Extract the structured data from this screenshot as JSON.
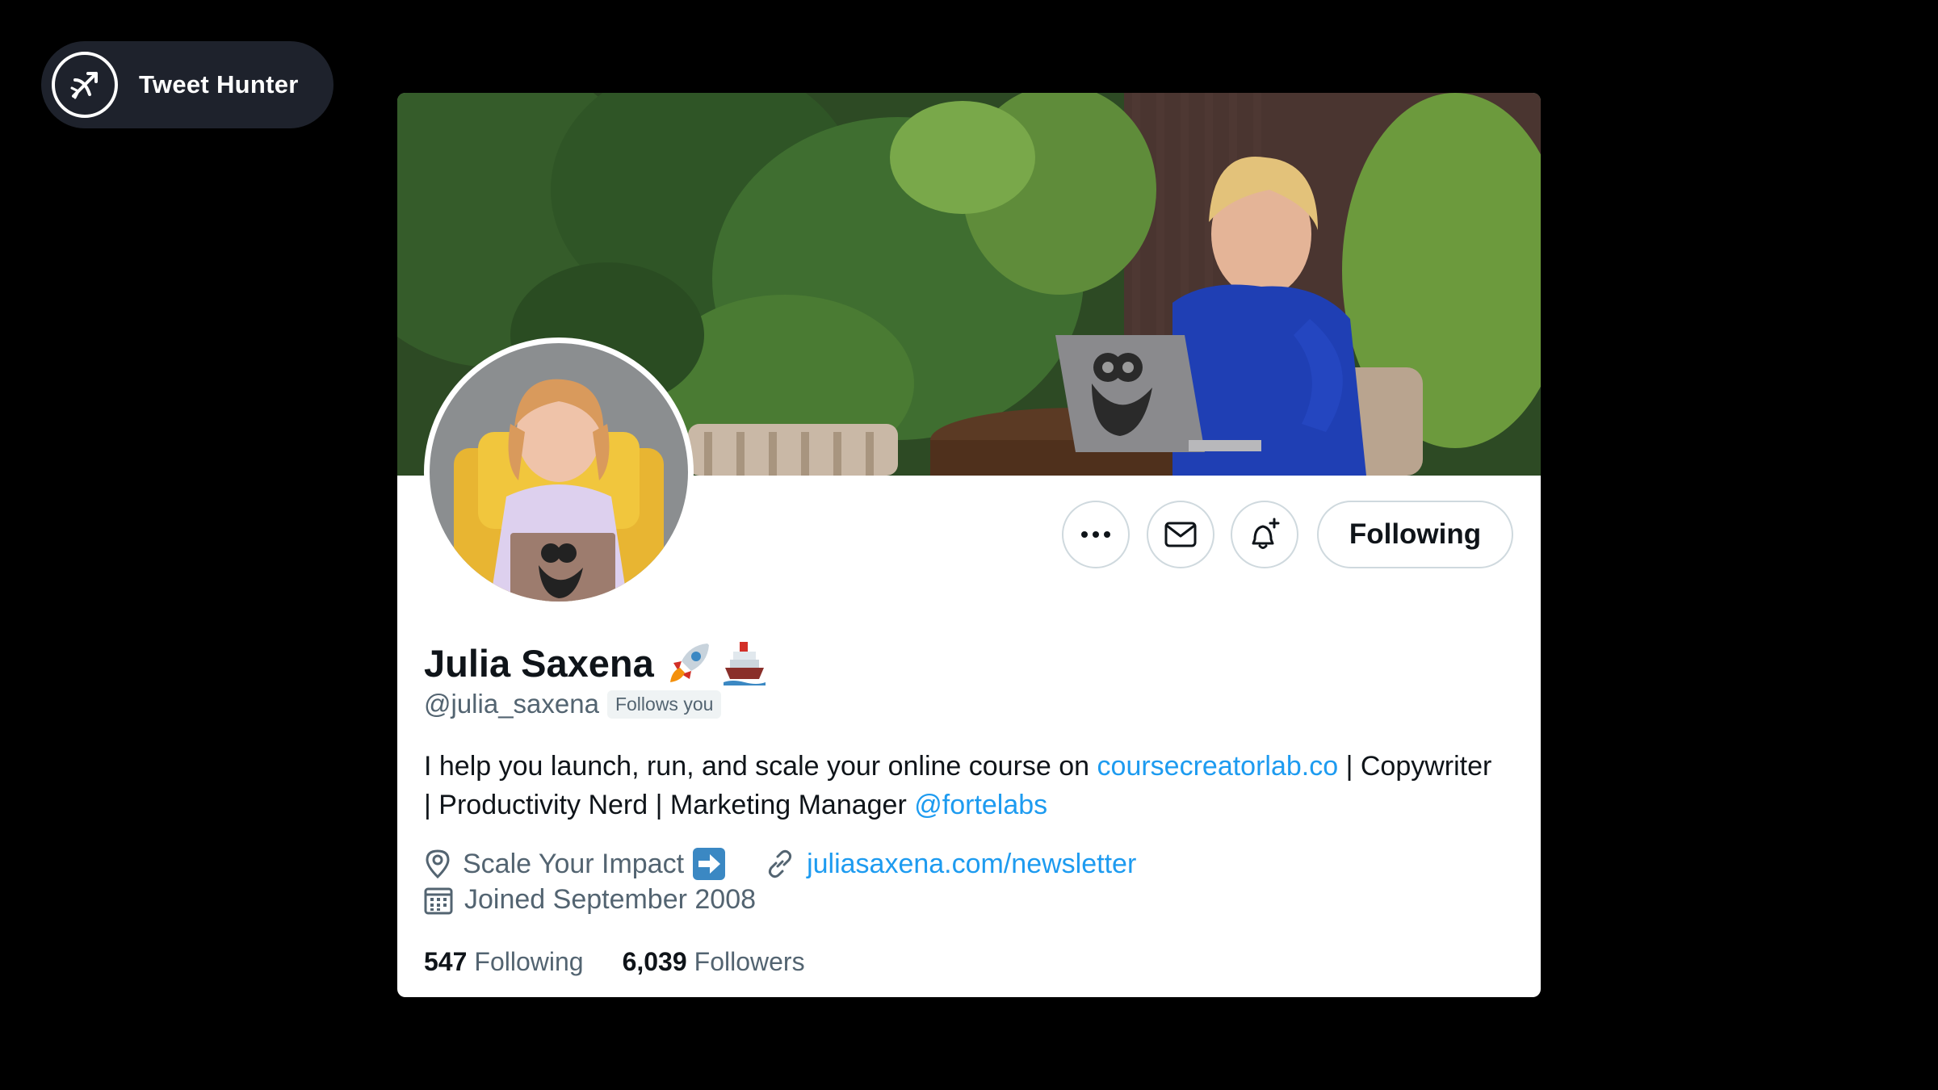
{
  "brand": {
    "name": "Tweet Hunter",
    "icon": "tweet-hunter-logo-icon"
  },
  "profile": {
    "display_name": "Julia Saxena",
    "name_emojis": [
      "rocket",
      "ship"
    ],
    "handle": "@julia_saxena",
    "follows_you": "Follows you",
    "bio": {
      "part1": "I help you launch, run, and scale your online course on ",
      "link1": "coursecreatorlab.co",
      "part2": " | Copywriter | Productivity Nerd | Marketing Manager ",
      "link2": "@fortelabs"
    },
    "location": "Scale Your Impact",
    "location_emoji": "right-arrow",
    "website": "juliasaxena.com/newsletter",
    "joined": "Joined September 2008",
    "following_count": "547",
    "following_label": "Following",
    "followers_count": "6,039",
    "followers_label": "Followers"
  },
  "actions": {
    "more": "more-icon",
    "message": "mail-icon",
    "notify": "bell-plus-icon",
    "following_button": "Following"
  },
  "colors": {
    "link": "#1d9bf0",
    "secondary_text": "#536471",
    "primary_text": "#0f1419",
    "background": "#000000"
  }
}
